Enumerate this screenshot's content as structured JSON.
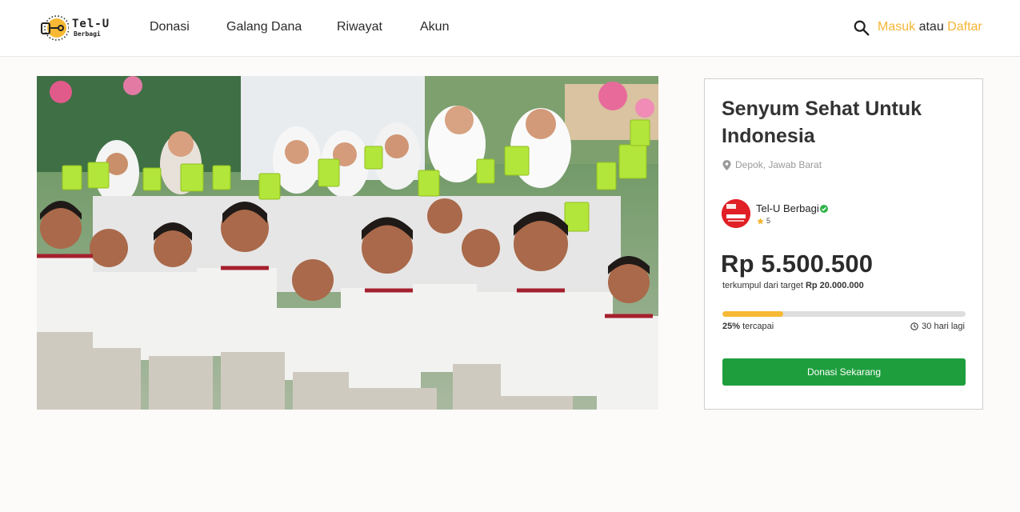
{
  "header": {
    "logo": {
      "line1": "Tel-U",
      "line2": "Berbagi"
    },
    "nav": [
      {
        "label": "Donasi"
      },
      {
        "label": "Galang Dana"
      },
      {
        "label": "Riwayat"
      },
      {
        "label": "Akun"
      }
    ],
    "auth": {
      "login_label": "Masuk",
      "separator": "atau",
      "register_label": "Daftar"
    },
    "icons": {
      "search": "search-icon"
    }
  },
  "campaign": {
    "image": {
      "icon": "campaign-photo"
    },
    "title": "Senyum Sehat Untuk Indonesia",
    "location": "Depok, Jawab Barat",
    "organizer": {
      "name": "Tel-U Berbagi",
      "rating": "5",
      "verified": true
    },
    "amount_collected": "Rp 5.500.500",
    "target_prefix": "terkumpul dari target",
    "target_amount": "Rp 20.000.000",
    "progress_percent": 25,
    "progress_label": "25%",
    "progress_suffix": "tercapai",
    "days_left": "30 hari lagi",
    "donate_label": "Donasi Sekarang"
  },
  "colors": {
    "accent": "#f5b535",
    "primary_button": "#1f9e3e",
    "progress_fill": "#f7b934",
    "progress_track": "#dedede",
    "verified": "#2fb34a"
  }
}
